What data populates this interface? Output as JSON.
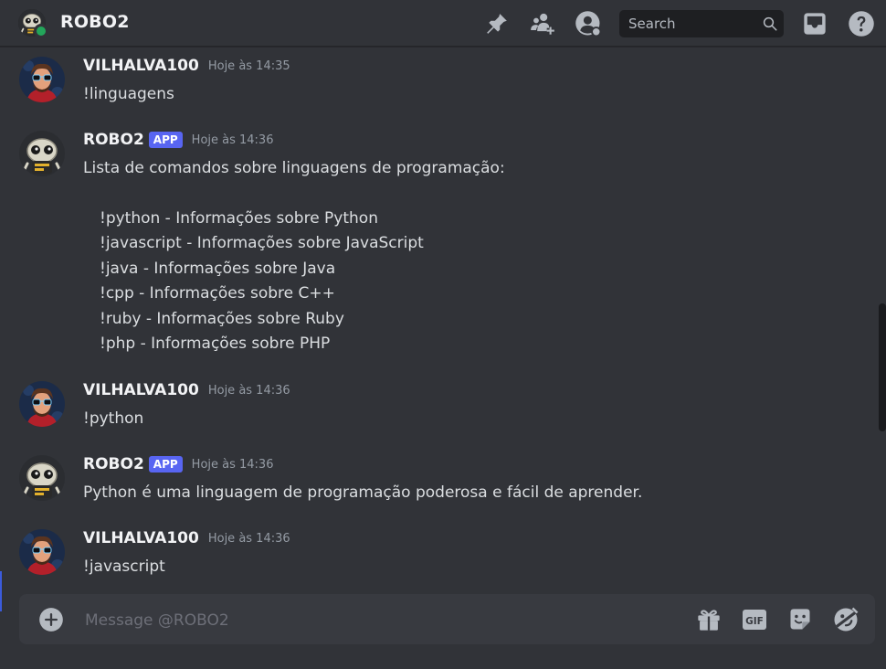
{
  "header": {
    "title": "ROBO2",
    "search_placeholder": "Search",
    "icons": [
      "pin-icon",
      "add-friend-icon",
      "user-profile-icon",
      "search-icon",
      "inbox-icon",
      "help-icon"
    ]
  },
  "messages": [
    {
      "username": "VILHALVA100",
      "is_app": false,
      "timestamp": "Hoje às 14:35",
      "text": "!linguagens"
    },
    {
      "username": "ROBO2",
      "is_app": true,
      "badge": "APP",
      "timestamp": "Hoje às 14:36",
      "text": "Lista de comandos sobre linguagens de programação:",
      "list": [
        "!python - Informações sobre Python",
        "!javascript - Informações sobre JavaScript",
        "!java - Informações sobre Java",
        "!cpp - Informações sobre C++",
        "!ruby - Informações sobre Ruby",
        "!php - Informações sobre PHP"
      ]
    },
    {
      "username": "VILHALVA100",
      "is_app": false,
      "timestamp": "Hoje às 14:36",
      "text": "!python"
    },
    {
      "username": "ROBO2",
      "is_app": true,
      "badge": "APP",
      "timestamp": "Hoje às 14:36",
      "text": "Python é uma linguagem de programação poderosa e fácil de aprender."
    },
    {
      "username": "VILHALVA100",
      "is_app": false,
      "timestamp": "Hoje às 14:36",
      "text": "!javascript"
    }
  ],
  "composer": {
    "placeholder": "Message @ROBO2",
    "icons": [
      "add-attachment-icon",
      "gift-icon",
      "gif-icon",
      "sticker-icon",
      "emoji-icon"
    ],
    "gif_label": "GIF"
  },
  "colors": {
    "background": "#313338",
    "composer": "#383a40",
    "badge": "#5865f2",
    "online": "#23a55a",
    "timestamp": "#949ba4"
  }
}
